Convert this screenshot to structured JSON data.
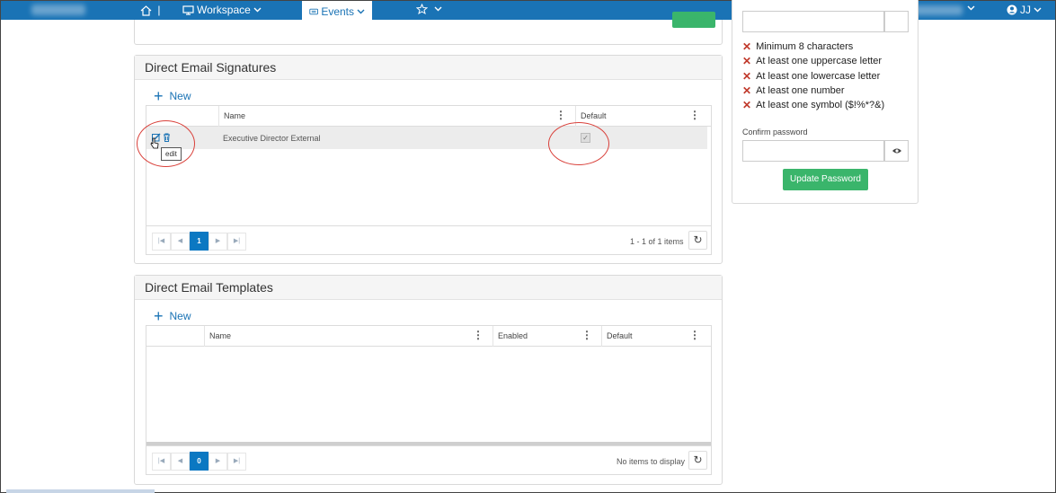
{
  "nav": {
    "home_separator": "|",
    "workspace_label": "Workspace",
    "events_label": "Events",
    "user_initials": "JJ"
  },
  "top_panel": {
    "update_label": "Update"
  },
  "signatures": {
    "title": "Direct Email Signatures",
    "new_label": "New",
    "columns": [
      "Name",
      "Default"
    ],
    "rows": [
      {
        "name": "Executive Director External",
        "default": true
      }
    ],
    "tooltip": "edit",
    "current_page": "1",
    "page_info": "1 - 1 of 1 items"
  },
  "templates": {
    "title": "Direct Email Templates",
    "new_label": "New",
    "columns": [
      "Name",
      "Enabled",
      "Default"
    ],
    "current_page": "0",
    "page_info": "No items to display"
  },
  "password": {
    "rules": [
      "Minimum 8 characters",
      "At least one uppercase letter",
      "At least one lowercase letter",
      "At least one number",
      "At least one symbol ($!%*?&)"
    ],
    "confirm_label": "Confirm password",
    "confirm_value": "",
    "update_label": "Update Password"
  }
}
